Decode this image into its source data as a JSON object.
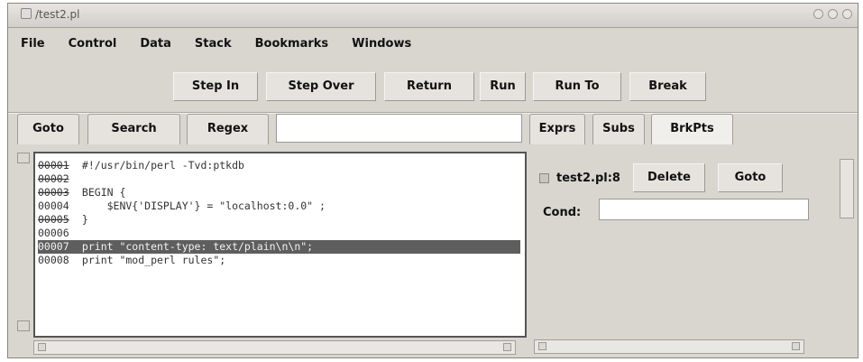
{
  "window": {
    "title": "/test2.pl"
  },
  "menu": [
    "File",
    "Control",
    "Data",
    "Stack",
    "Bookmarks",
    "Windows"
  ],
  "toolbar": {
    "step_in": "Step In",
    "step_over": "Step Over",
    "return": "Return",
    "run": "Run",
    "run_to": "Run To",
    "break": "Break"
  },
  "left_tabs": {
    "goto": "Goto",
    "search": "Search",
    "regex": "Regex"
  },
  "search": {
    "value": ""
  },
  "code": [
    {
      "num": "00001",
      "text": " #!/usr/bin/perl -Tvd:ptkdb",
      "struck": true,
      "highlight": false
    },
    {
      "num": "00002",
      "text": "",
      "struck": true,
      "highlight": false
    },
    {
      "num": "00003",
      "text": " BEGIN {",
      "struck": true,
      "highlight": false
    },
    {
      "num": "00004",
      "text": "     $ENV{'DISPLAY'} = \"localhost:0.0\" ;",
      "struck": false,
      "highlight": false
    },
    {
      "num": "00005",
      "text": " }",
      "struck": true,
      "highlight": false
    },
    {
      "num": "00006",
      "text": "",
      "struck": false,
      "highlight": false
    },
    {
      "num": "00007",
      "text": " print \"content-type: text/plain\\n\\n\";",
      "struck": false,
      "highlight": true
    },
    {
      "num": "00008",
      "text": " print \"mod_perl rules\";",
      "struck": false,
      "highlight": false
    }
  ],
  "right_tabs": {
    "exprs": "Exprs",
    "subs": "Subs",
    "brkpts": "BrkPts"
  },
  "breakpoint": {
    "location": "test2.pl:8",
    "delete_label": "Delete",
    "goto_label": "Goto",
    "cond_label": "Cond:",
    "cond_value": ""
  }
}
